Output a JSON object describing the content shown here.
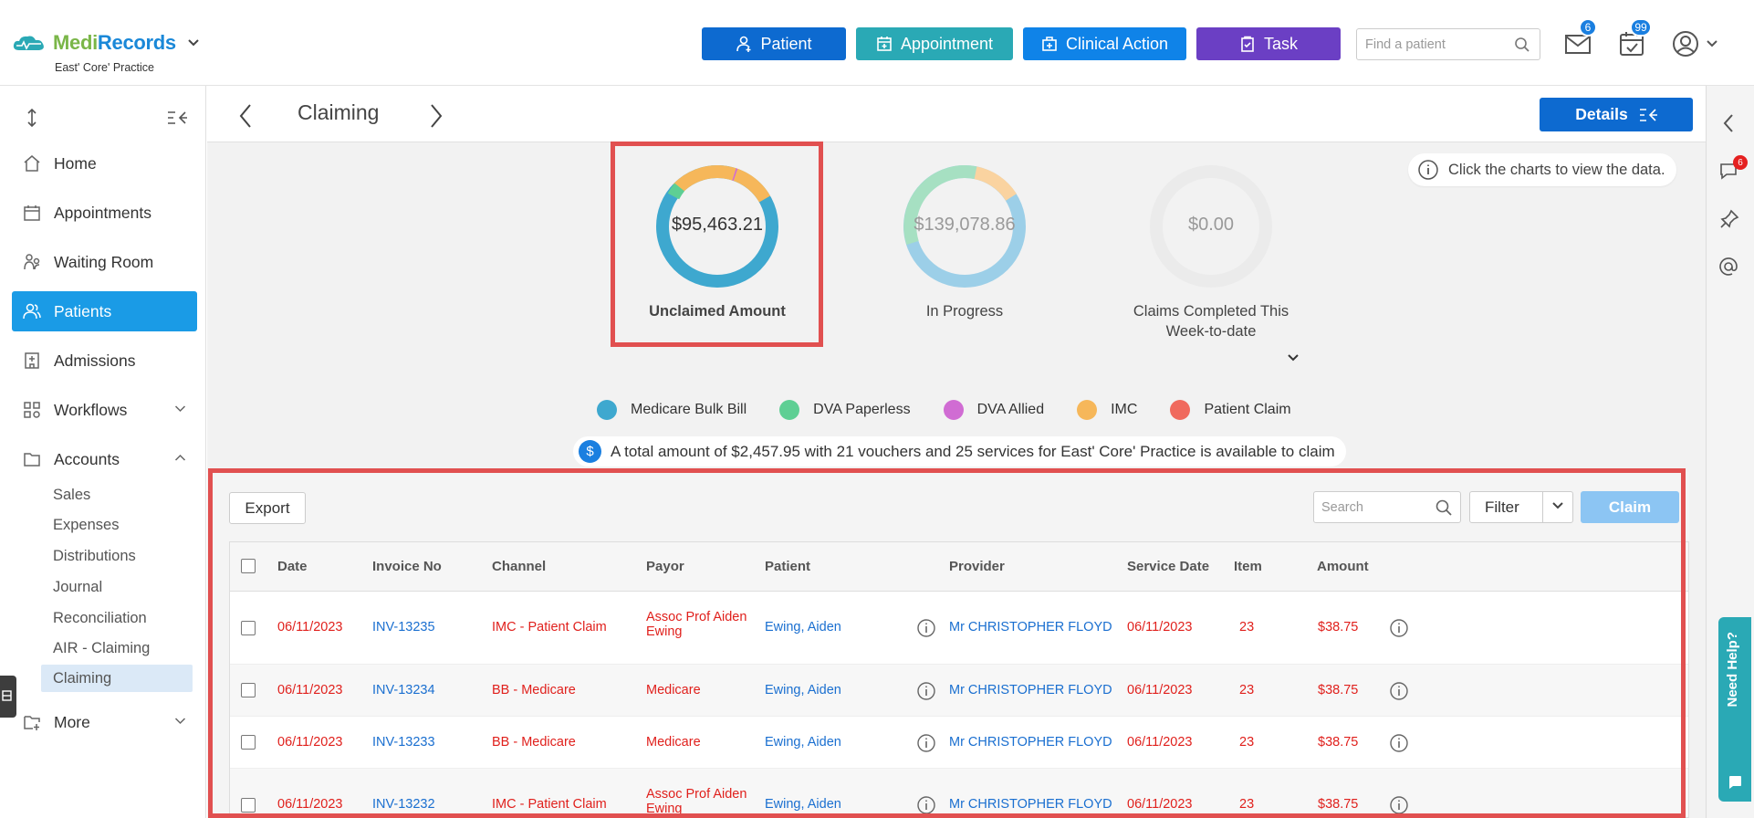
{
  "app": {
    "logo_part1": "Medi",
    "logo_part2": "Records",
    "practice": "East' Core' Practice"
  },
  "topbar": {
    "patient_label": "Patient",
    "appointment_label": "Appointment",
    "clinical_label": "Clinical Action",
    "task_label": "Task",
    "search_placeholder": "Find a patient",
    "mail_badge": "6",
    "calendar_badge": "99"
  },
  "sidebar": {
    "items": [
      {
        "label": "Home",
        "icon": "home-icon"
      },
      {
        "label": "Appointments",
        "icon": "calendar-icon"
      },
      {
        "label": "Waiting Room",
        "icon": "waiting-room-icon"
      },
      {
        "label": "Patients",
        "icon": "patients-icon"
      },
      {
        "label": "Admissions",
        "icon": "hospital-icon"
      },
      {
        "label": "Workflows",
        "icon": "workflows-icon"
      },
      {
        "label": "Accounts",
        "icon": "folder-icon"
      },
      {
        "label": "More",
        "icon": "more-icon"
      }
    ],
    "sub_items": [
      "Sales",
      "Expenses",
      "Distributions",
      "Journal",
      "Reconciliation",
      "AIR - Claiming",
      "Claiming"
    ]
  },
  "page": {
    "title": "Claiming",
    "details_label": "Details",
    "hint": "Click the charts to view the data.",
    "summary": "A total amount of $2,457.95 with 21 vouchers and 25 services for East' Core' Practice is available to claim"
  },
  "charts": [
    {
      "value": "$95,463.21",
      "label": "Unclaimed Amount"
    },
    {
      "value": "$139,078.86",
      "label": "In Progress"
    },
    {
      "value": "$0.00",
      "label": "Claims Completed This Week-to-date"
    }
  ],
  "legend": [
    {
      "label": "Medicare Bulk Bill",
      "color": "#3ea8cf"
    },
    {
      "label": "DVA Paperless",
      "color": "#5ecf94"
    },
    {
      "label": "DVA Allied",
      "color": "#d06cd3"
    },
    {
      "label": "IMC",
      "color": "#f6b75a"
    },
    {
      "label": "Patient Claim",
      "color": "#f06a5e"
    }
  ],
  "toolbar": {
    "export_label": "Export",
    "search_placeholder": "Search",
    "filter_label": "Filter",
    "claim_label": "Claim"
  },
  "table": {
    "columns": [
      "Date",
      "Invoice No",
      "Channel",
      "Payor",
      "Patient",
      "Provider",
      "Service Date",
      "Item",
      "Amount"
    ],
    "rows": [
      {
        "date": "06/11/2023",
        "invoice": "INV-13235",
        "channel": "IMC - Patient Claim",
        "payor_line1": "Assoc Prof Aiden",
        "payor_line2": "Ewing",
        "patient": "Ewing, Aiden",
        "provider": "Mr CHRISTOPHER FLOYD",
        "service_date": "06/11/2023",
        "item": "23",
        "amount": "$38.75"
      },
      {
        "date": "06/11/2023",
        "invoice": "INV-13234",
        "channel": "BB - Medicare",
        "payor_line1": "Medicare",
        "payor_line2": "",
        "patient": "Ewing, Aiden",
        "provider": "Mr CHRISTOPHER FLOYD",
        "service_date": "06/11/2023",
        "item": "23",
        "amount": "$38.75"
      },
      {
        "date": "06/11/2023",
        "invoice": "INV-13233",
        "channel": "BB - Medicare",
        "payor_line1": "Medicare",
        "payor_line2": "",
        "patient": "Ewing, Aiden",
        "provider": "Mr CHRISTOPHER FLOYD",
        "service_date": "06/11/2023",
        "item": "23",
        "amount": "$38.75"
      },
      {
        "date": "06/11/2023",
        "invoice": "INV-13232",
        "channel": "IMC - Patient Claim",
        "payor_line1": "Assoc Prof Aiden",
        "payor_line2": "Ewing",
        "patient": "Ewing, Aiden",
        "provider": "Mr CHRISTOPHER FLOYD",
        "service_date": "06/11/2023",
        "item": "23",
        "amount": "$38.75"
      }
    ]
  },
  "rail": {
    "chat_badge": "6",
    "help_label": "Need Help?"
  }
}
